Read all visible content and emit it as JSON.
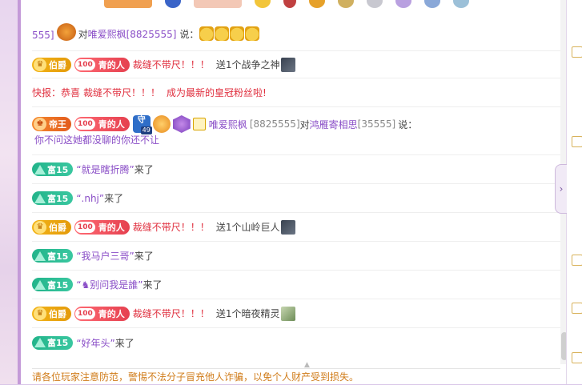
{
  "rows": [
    {
      "prefix": "555]",
      "verb": "对",
      "user": "唯爱熙枫[8825555]",
      "said": "说："
    },
    {
      "badge": "伯爵",
      "level": "100",
      "tag": "青的人",
      "sender": "裁缝不带尺！！！",
      "gift": "送1个战争之神"
    },
    {
      "flash_label": "快报：恭喜",
      "sender": "裁缝不带尺！！！",
      "flash_text": "成为最新的皇冠粉丝啦!"
    },
    {
      "badge": "帝王",
      "level": "100",
      "tag": "青的人",
      "medal_level": "49",
      "medal_char": "守",
      "user": "唯爱熙枫",
      "user_id": "[8825555]",
      "verb": "对",
      "target": "鸿雁寄相思",
      "target_id": "[35555]",
      "said": "说：",
      "message": "你不问这她都没聊的你还不让"
    },
    {
      "badge": "富15",
      "user": "“就是瞎折腾”",
      "action": "来了"
    },
    {
      "badge": "富15",
      "user": "“.nhj”",
      "action": "来了"
    },
    {
      "badge": "伯爵",
      "level": "100",
      "tag": "青的人",
      "sender": "裁缝不带尺！！！",
      "gift": "送1个山岭巨人"
    },
    {
      "badge": "富15",
      "user": "“我马户三哥”",
      "action": "来了"
    },
    {
      "badge": "富15",
      "user": "“♞别问我是誰”",
      "action": "来了"
    },
    {
      "badge": "伯爵",
      "level": "100",
      "tag": "青的人",
      "sender": "裁缝不带尺！！！",
      "gift": "送1个暗夜精灵"
    },
    {
      "badge": "富15",
      "user": "“好年头”",
      "action": "来了"
    }
  ],
  "notice": "请各位玩家注意防范，警惕不法分子冒充他人诈骗，以免个人财产受到损失。",
  "collapse_label": "›",
  "colors": {
    "accent": "#8a4ec7",
    "alert": "#e0303f",
    "notice": "#d07c1a"
  }
}
